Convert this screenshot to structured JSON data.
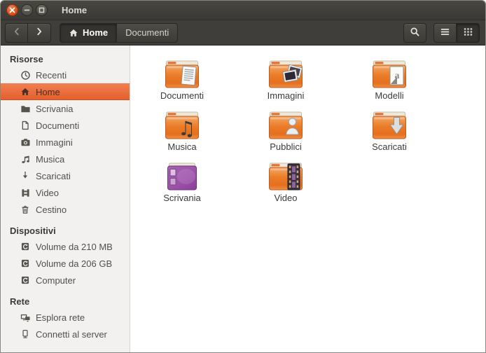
{
  "window": {
    "title": "Home"
  },
  "titlebar": {
    "controls": [
      {
        "name": "close"
      },
      {
        "name": "minimize"
      },
      {
        "name": "maximize"
      }
    ]
  },
  "toolbar": {
    "back_icon": "chevron-left-icon",
    "forward_icon": "chevron-right-icon",
    "breadcrumbs": [
      {
        "label": "Home",
        "icon": "home",
        "active": true
      },
      {
        "label": "Documenti",
        "active": false
      }
    ],
    "search_icon": "search-icon",
    "views": [
      {
        "name": "list-view",
        "icon": "list",
        "active": false
      },
      {
        "name": "grid-view",
        "icon": "grid",
        "active": true
      }
    ]
  },
  "sidebar": {
    "sections": [
      {
        "header": "Risorse",
        "items": [
          {
            "label": "Recenti",
            "icon": "recent"
          },
          {
            "label": "Home",
            "icon": "home",
            "selected": true
          },
          {
            "label": "Scrivania",
            "icon": "desktop"
          },
          {
            "label": "Documenti",
            "icon": "document"
          },
          {
            "label": "Immagini",
            "icon": "camera"
          },
          {
            "label": "Musica",
            "icon": "music"
          },
          {
            "label": "Scaricati",
            "icon": "download"
          },
          {
            "label": "Video",
            "icon": "video"
          },
          {
            "label": "Cestino",
            "icon": "trash"
          }
        ]
      },
      {
        "header": "Dispositivi",
        "items": [
          {
            "label": "Volume da 210 MB",
            "icon": "drive"
          },
          {
            "label": "Volume da 206 GB",
            "icon": "drive"
          },
          {
            "label": "Computer",
            "icon": "drive"
          }
        ]
      },
      {
        "header": "Rete",
        "items": [
          {
            "label": "Esplora rete",
            "icon": "network"
          },
          {
            "label": "Connetti al server",
            "icon": "server"
          }
        ]
      }
    ]
  },
  "content": {
    "items": [
      {
        "label": "Documenti",
        "icon": "folder-documents"
      },
      {
        "label": "Immagini",
        "icon": "folder-images"
      },
      {
        "label": "Modelli",
        "icon": "folder-templates"
      },
      {
        "label": "Musica",
        "icon": "folder-music"
      },
      {
        "label": "Pubblici",
        "icon": "folder-public"
      },
      {
        "label": "Scaricati",
        "icon": "folder-downloads"
      },
      {
        "label": "Scrivania",
        "icon": "desktop-icon"
      },
      {
        "label": "Video",
        "icon": "folder-video"
      }
    ]
  },
  "colors": {
    "accent_orange": "#e95420",
    "selection_gradient_top": "#f27e50",
    "selection_gradient_bottom": "#e2602c",
    "titlebar_bg": "#403e3a",
    "sidebar_bg": "#f2f1f0",
    "folder_orange": "#e97a26",
    "desktop_purple": "#9b4fa8",
    "content_bg": "#ffffff"
  }
}
